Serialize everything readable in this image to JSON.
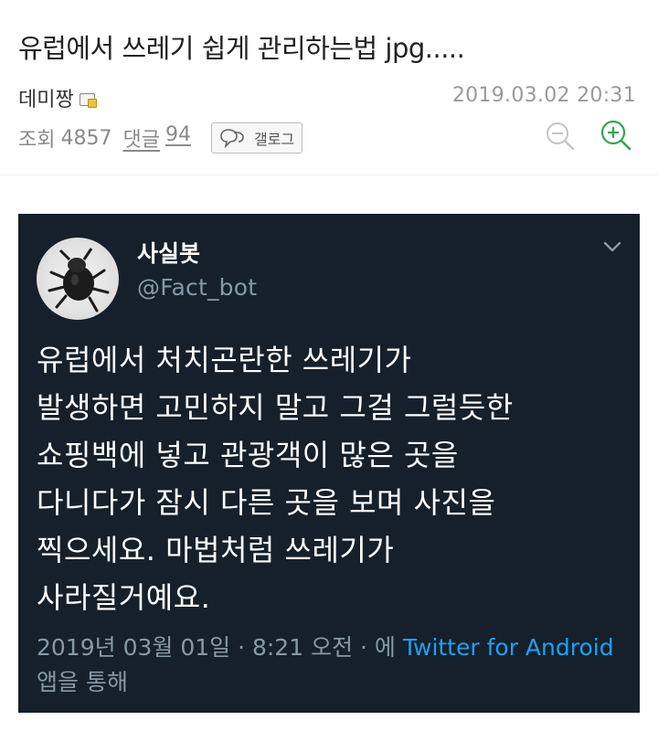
{
  "post": {
    "title": "유럽에서 쓰레기 쉽게 관리하는법 jpg.....",
    "author": "데미짱",
    "date": "2019.03.02 20:31",
    "view_label": "조회",
    "view_count": "4857",
    "comment_label": "댓글",
    "comment_count": "94",
    "gallog_label": "갤로그"
  },
  "icons": {
    "author_badge": "gallery-badge-icon",
    "gallog": "speech-bubble-icon",
    "zoom_out": "zoom-out-icon",
    "zoom_in": "zoom-in-icon",
    "tweet_menu": "chevron-down-icon"
  },
  "colors": {
    "tweet_background": "#15202b",
    "zoom_in": "#2fa84f",
    "link": "#1da1f2"
  },
  "tweet": {
    "name": "사실봇",
    "handle": "@Fact_bot",
    "lines": [
      "유럽에서 처치곤란한 쓰레기가",
      "발생하면 고민하지 말고 그걸 그럴듯한",
      "쇼핑백에 넣고 관광객이 많은 곳을",
      "다니다가 잠시 다른 곳을 보며 사진을",
      "찍으세요. 마법처럼 쓰레기가",
      "사라질거예요."
    ],
    "footer_prefix": "2019년 03월 01일 · 8:21 오전 · 에 ",
    "footer_link": "Twitter for Android",
    "footer_suffix": " 앱을 통해"
  }
}
